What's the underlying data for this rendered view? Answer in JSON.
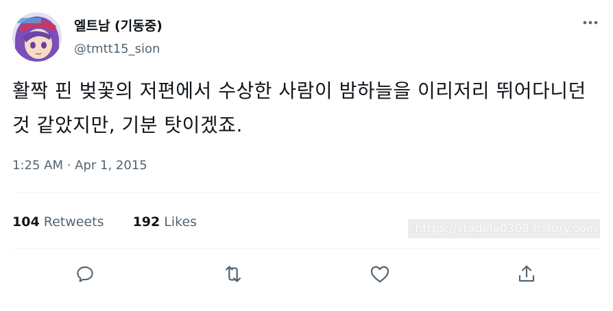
{
  "user": {
    "display_name": "엘트남 (기동중)",
    "handle": "@tmtt15_sion"
  },
  "tweet": {
    "text": "활짝 핀 벚꽃의 저편에서 수상한 사람이 밤하늘을 이리저리 뛰어다니던 것 같았지만, 기분 탓이겠죠.",
    "timestamp": "1:25 AM · Apr 1, 2015"
  },
  "stats": {
    "retweets_count": "104",
    "retweets_label": "Retweets",
    "likes_count": "192",
    "likes_label": "Likes"
  },
  "watermark": "https://stadela0309.tistory.com",
  "actions": {
    "icons": [
      "reply-icon",
      "retweet-icon",
      "like-icon",
      "share-icon"
    ]
  },
  "colors": {
    "text_primary": "#0f1419",
    "text_secondary": "#536471",
    "divider": "#eff3f4"
  }
}
